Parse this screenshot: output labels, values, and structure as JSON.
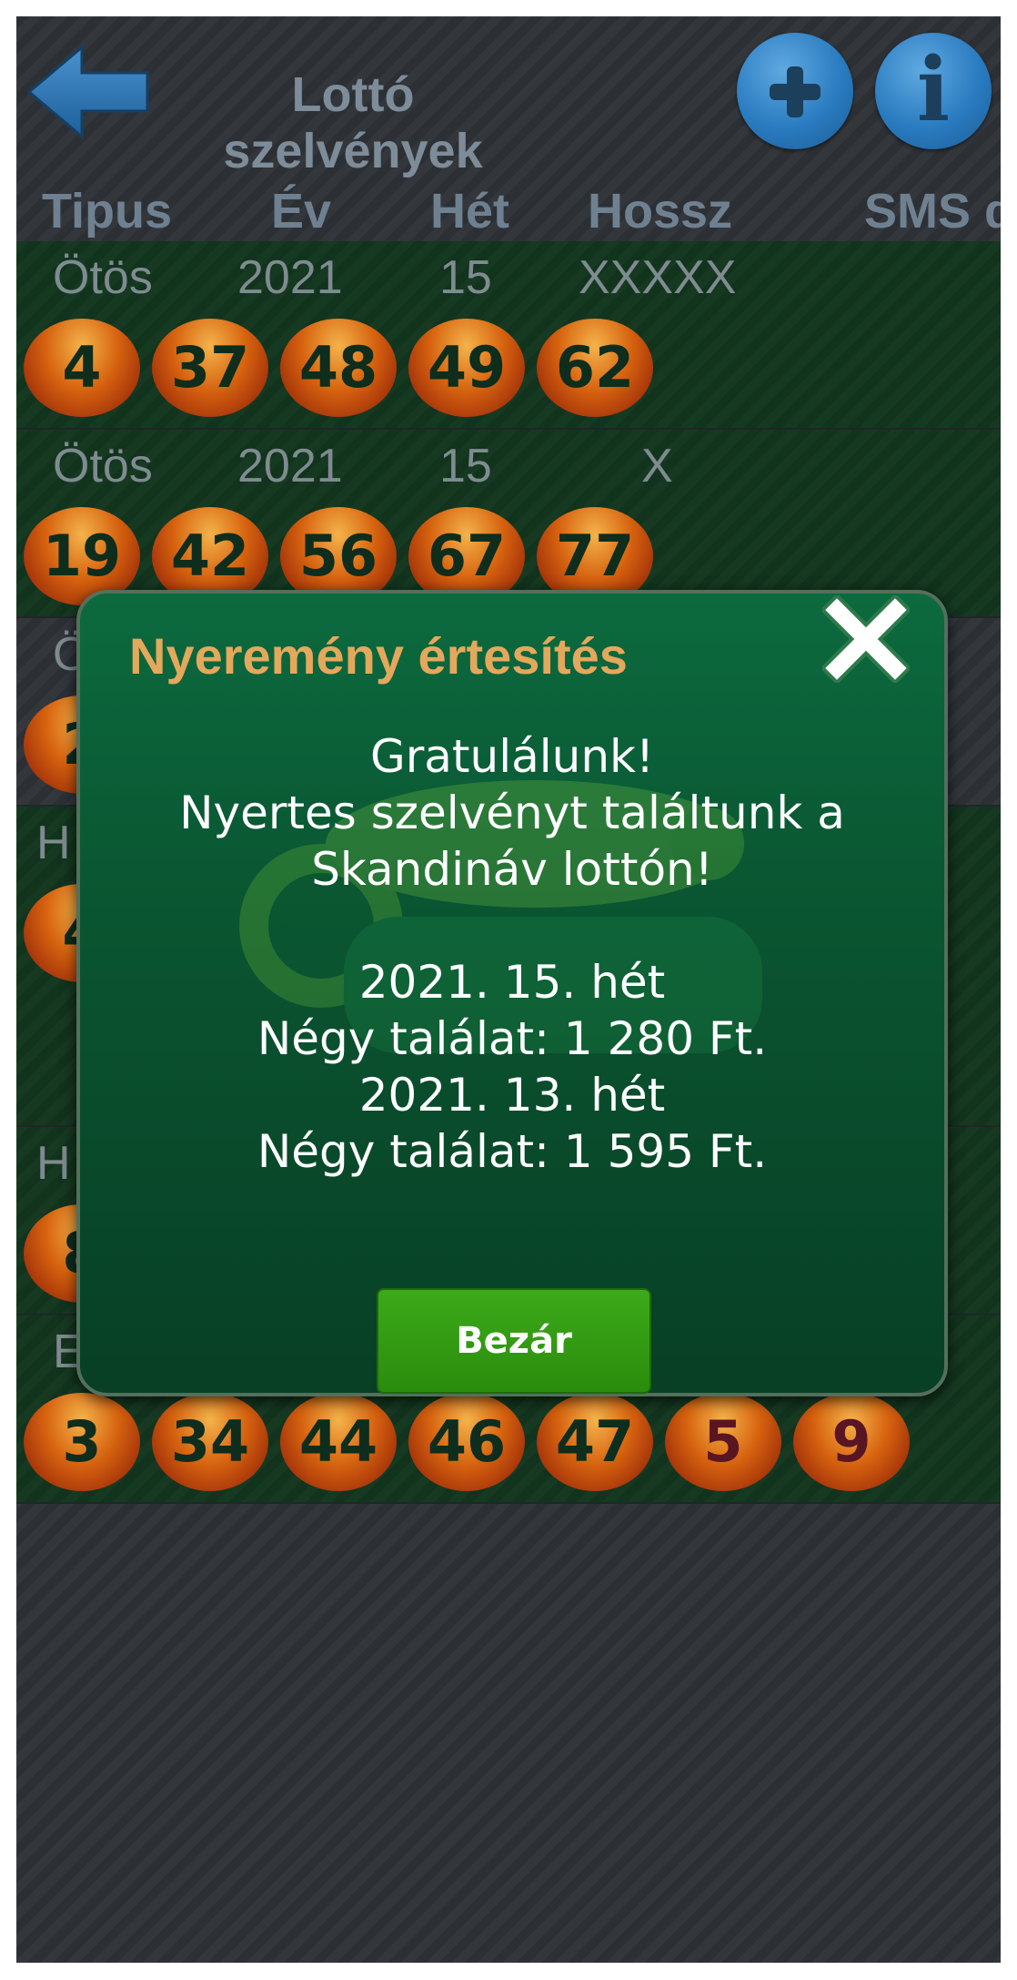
{
  "header": {
    "title": "Lottó szelvények"
  },
  "columns": [
    "Tipus",
    "Év",
    "Hét",
    "Hossz",
    "SMS d"
  ],
  "tickets": [
    {
      "type": "Ötös",
      "year": "2021",
      "week": "15",
      "length": "XXXXX",
      "numbers": [
        "4",
        "37",
        "48",
        "49",
        "62"
      ],
      "extra": []
    },
    {
      "type": "Ötös",
      "year": "2021",
      "week": "15",
      "length": "X",
      "numbers": [
        "19",
        "42",
        "56",
        "67",
        "77"
      ],
      "extra": []
    },
    {
      "type": "Ö",
      "year": "",
      "week": "",
      "length": "",
      "numbers": [
        "2"
      ],
      "extra": []
    },
    {
      "type": "H",
      "year": "",
      "week": "",
      "length": "",
      "numbers": [
        "4"
      ],
      "extra": []
    },
    {
      "type": "H",
      "year": "",
      "week": "",
      "length": "",
      "numbers": [
        "8"
      ],
      "extra": []
    },
    {
      "type": "E",
      "year": "",
      "week": "",
      "length": "",
      "numbers": [
        "3",
        "34",
        "44",
        "46",
        "47"
      ],
      "extra": [
        "5",
        "9"
      ]
    }
  ],
  "dialog": {
    "title": "Nyeremény értesítés",
    "message_lines": [
      "Gratulálunk!",
      "Nyertes szelvényt találtunk a",
      "Skandináv lottón!",
      "2021. 15. hét",
      "Négy találat: 1 280 Ft.",
      "2021. 13. hét",
      "Négy találat: 1 595 Ft."
    ],
    "close_button": "Bezár"
  },
  "colors": {
    "dialog_title": "#e4a85c",
    "dialog_bg": "#0a5531",
    "button_green": "#2b8c0d",
    "ball_orange": "#d6620f",
    "icon_blue": "#2a7bc0"
  }
}
